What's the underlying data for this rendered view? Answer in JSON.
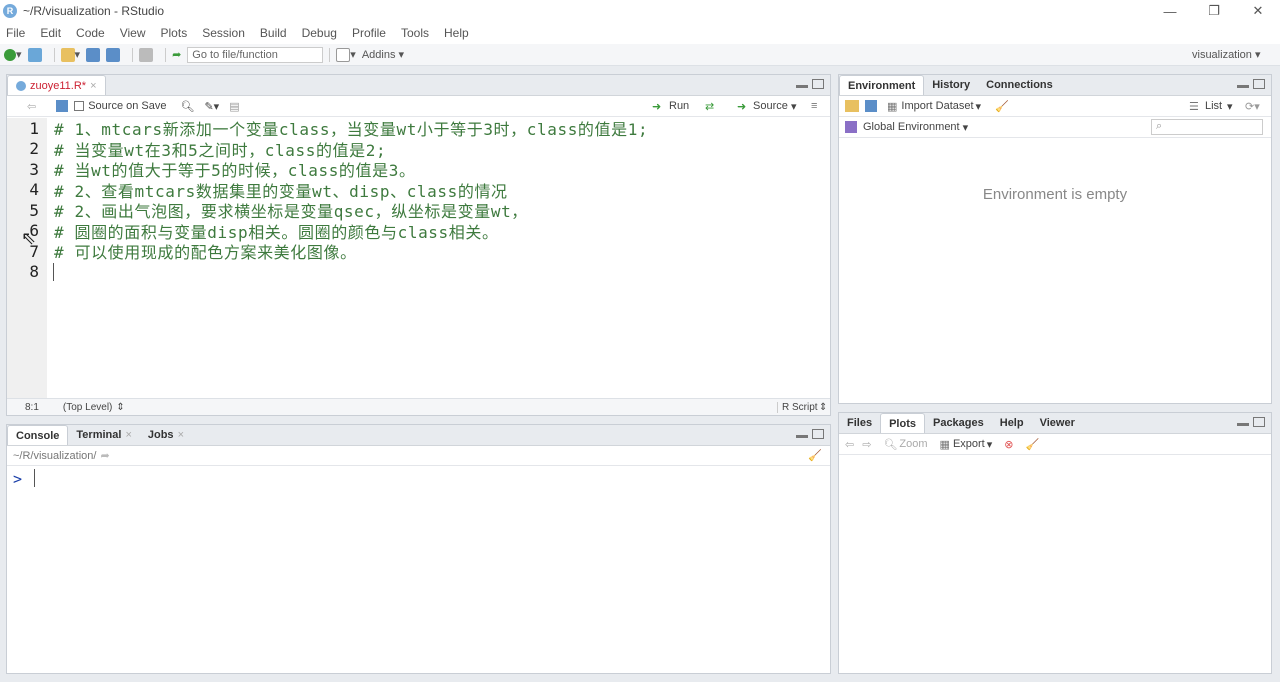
{
  "window": {
    "title": "~/R/visualization - RStudio",
    "app_letter": "R"
  },
  "menu": [
    "File",
    "Edit",
    "Code",
    "View",
    "Plots",
    "Session",
    "Build",
    "Debug",
    "Profile",
    "Tools",
    "Help"
  ],
  "toolbar": {
    "goto_placeholder": "Go to file/function",
    "addins": "Addins",
    "project": "visualization"
  },
  "editor": {
    "tab_label": "zuoye11.R*",
    "source_on_save": "Source on Save",
    "run": "Run",
    "source": "Source",
    "lines": [
      {
        "num": "1",
        "text": "# 1、mtcars新添加一个变量class，当变量wt小于等于3时，class的值是1;"
      },
      {
        "num": "2",
        "text": "# 当变量wt在3和5之间时，class的值是2;"
      },
      {
        "num": "3",
        "text": "# 当wt的值大于等于5的时候，class的值是3。"
      },
      {
        "num": "4",
        "text": "# 2、查看mtcars数据集里的变量wt、disp、class的情况"
      },
      {
        "num": "5",
        "text": "# 2、画出气泡图，要求横坐标是变量qsec，纵坐标是变量wt，"
      },
      {
        "num": "6",
        "text": "# 圆圈的面积与变量disp相关。圆圈的颜色与class相关。"
      },
      {
        "num": "7",
        "text": "# 可以使用现成的配色方案来美化图像。"
      },
      {
        "num": "8",
        "text": ""
      }
    ],
    "status_pos": "8:1",
    "status_scope": "(Top Level)",
    "status_type": "R Script"
  },
  "console": {
    "tabs": [
      {
        "label": "Console"
      },
      {
        "label": "Terminal"
      },
      {
        "label": "Jobs"
      }
    ],
    "path": "~/R/visualization/",
    "prompt": ">"
  },
  "env": {
    "tabs": [
      "Environment",
      "History",
      "Connections"
    ],
    "import_dataset": "Import Dataset",
    "list": "List",
    "global_env": "Global Environment",
    "empty_message": "Environment is empty"
  },
  "files": {
    "tabs": [
      "Files",
      "Plots",
      "Packages",
      "Help",
      "Viewer"
    ],
    "zoom": "Zoom",
    "export": "Export"
  }
}
